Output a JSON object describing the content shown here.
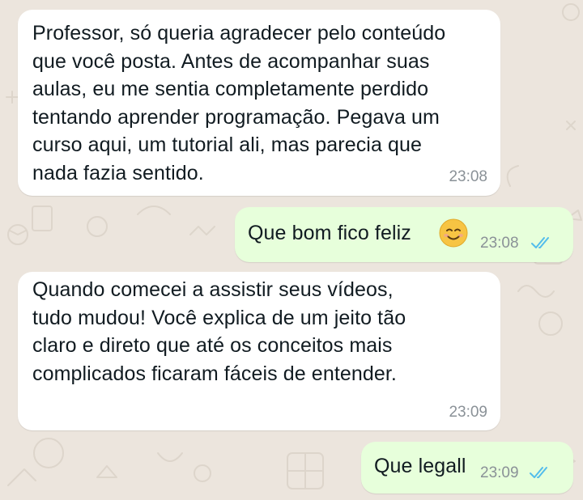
{
  "chat": {
    "background_color": "#ece5dd",
    "incoming_bubble_color": "#ffffff",
    "outgoing_bubble_color": "#e7ffdb",
    "tick_color": "#53bdeb",
    "messages": [
      {
        "direction": "incoming",
        "text": "Professor, só queria agradecer pelo conteúdo\nque você posta. Antes de acompanhar suas\naulas, eu me sentia completamente perdido\ntentando aprender programação. Pegava um\ncurso aqui, um tutorial ali, mas parecia que\nnada fazia sentido.",
        "time": "23:08"
      },
      {
        "direction": "outgoing",
        "text": "Que bom fico feliz",
        "emoji": "smiling-face-icon",
        "time": "23:08",
        "status": "read"
      },
      {
        "direction": "incoming",
        "text": "Quando comecei a assistir seus vídeos,\ntudo mudou! Você explica de um jeito tão\nclaro e direto que até os conceitos mais\ncomplicados ficaram fáceis de entender.",
        "time": "23:09"
      },
      {
        "direction": "outgoing",
        "text": "Que legall",
        "time": "23:09",
        "status": "read"
      }
    ]
  }
}
